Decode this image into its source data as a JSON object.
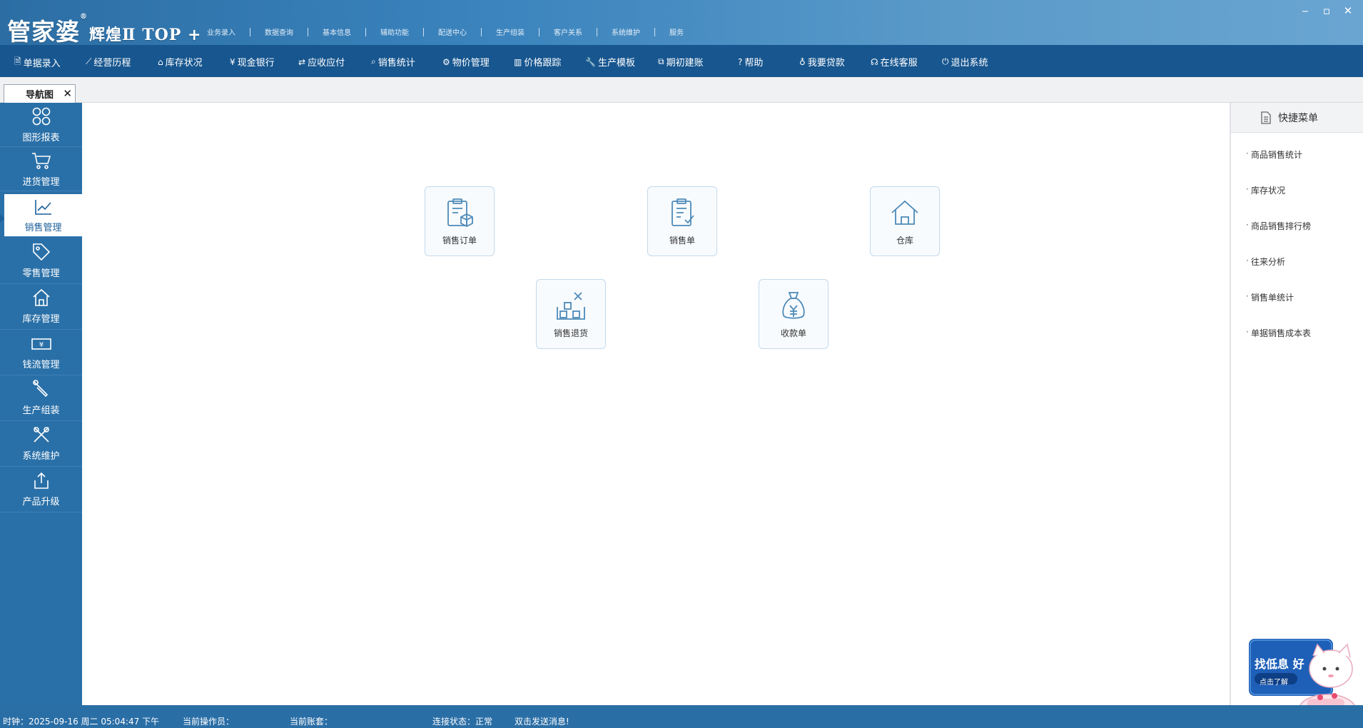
{
  "app": {
    "logo_main": "管家婆",
    "logo_sub": "辉煌Ⅱ TOP +",
    "logo_reg": "®"
  },
  "topmenu": [
    "业务录入",
    "数据查询",
    "基本信息",
    "辅助功能",
    "配送中心",
    "生产组装",
    "客户关系",
    "系统维护",
    "服务"
  ],
  "window_controls": {
    "minimize": "‒",
    "maximize": "▫",
    "close": "✕"
  },
  "toolbar": [
    {
      "label": "单据录入",
      "icon": "document-edit-icon",
      "glyph": "🗎"
    },
    {
      "label": "经营历程",
      "icon": "line-chart-icon",
      "glyph": "⟋"
    },
    {
      "label": "库存状况",
      "icon": "home-icon",
      "glyph": "⌂"
    },
    {
      "label": "现金银行",
      "icon": "yen-icon",
      "glyph": "¥"
    },
    {
      "label": "应收应付",
      "icon": "exchange-icon",
      "glyph": "⇄"
    },
    {
      "label": "销售统计",
      "icon": "search-icon",
      "glyph": "⌕"
    },
    {
      "label": "物价管理",
      "icon": "gear-icon",
      "glyph": "⚙"
    },
    {
      "label": "价格跟踪",
      "icon": "bar-chart-icon",
      "glyph": "▥"
    },
    {
      "label": "生产模板",
      "icon": "wrench-icon",
      "glyph": "🔧"
    },
    {
      "label": "期初建账",
      "icon": "external-link-icon",
      "glyph": "⧉"
    },
    {
      "label": "帮助",
      "icon": "question-icon",
      "glyph": "?"
    },
    {
      "label": "我要贷款",
      "icon": "money-bag-icon",
      "glyph": "♁"
    },
    {
      "label": "在线客服",
      "icon": "headset-icon",
      "glyph": "☊"
    },
    {
      "label": "退出系统",
      "icon": "power-icon",
      "glyph": "⏻"
    }
  ],
  "tab": {
    "label": "导航图",
    "close": "✕"
  },
  "sidebar": [
    {
      "label": "图形报表",
      "icon": "grid-icon"
    },
    {
      "label": "进货管理",
      "icon": "cart-icon"
    },
    {
      "label": "销售管理",
      "icon": "trend-icon",
      "active": true
    },
    {
      "label": "零售管理",
      "icon": "tag-icon"
    },
    {
      "label": "库存管理",
      "icon": "house-icon"
    },
    {
      "label": "钱流管理",
      "icon": "cash-icon"
    },
    {
      "label": "生产组装",
      "icon": "wrench-icon"
    },
    {
      "label": "系统维护",
      "icon": "tools-icon"
    },
    {
      "label": "产品升级",
      "icon": "upload-icon"
    }
  ],
  "tiles": [
    {
      "label": "销售订单",
      "icon": "order-box-icon"
    },
    {
      "label": "销售单",
      "icon": "clipboard-check-icon"
    },
    {
      "label": "仓库",
      "icon": "warehouse-icon"
    },
    {
      "label": "销售退货",
      "icon": "return-goods-icon"
    },
    {
      "label": "收款单",
      "icon": "money-bag-icon"
    }
  ],
  "quick_menu": {
    "title": "快捷菜单",
    "items": [
      "商品销售统计",
      "库存状况",
      "商品销售排行榜",
      "往来分析",
      "销售单统计",
      "单据销售成本表"
    ]
  },
  "ad": {
    "line1": "找低息 好",
    "line2": "点击了解"
  },
  "status": {
    "clock": "时钟：2025-09-16 周二 05:04:47 下午",
    "operator": "当前操作员：",
    "account": "当前账套：",
    "connection": "连接状态：正常",
    "message": "双击发送消息!"
  },
  "colors": {
    "toolbar_bg": "#17568f",
    "sidebar_bg": "#2a70a8",
    "accent": "#1c5f9a",
    "tile_icon": "#4d8ab8"
  }
}
